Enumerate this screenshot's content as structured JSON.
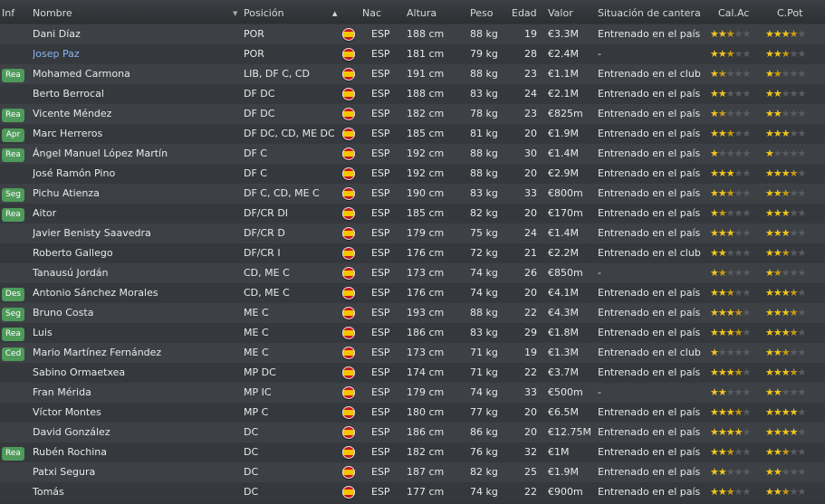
{
  "headers": {
    "inf": "Inf",
    "name": "Nombre",
    "pos": "Posición",
    "nat": "Nac",
    "height": "Altura",
    "weight": "Peso",
    "age": "Edad",
    "value": "Valor",
    "status": "Situación de cantera",
    "ca": "Cal.Ac",
    "pa": "C.Pot",
    "sort_arrow_name": "▼",
    "sort_arrow_pos": "▲"
  },
  "players": [
    {
      "inf": "",
      "name": "Dani Díaz",
      "pos": "POR",
      "nat": "ESP",
      "height": "188 cm",
      "weight": "88 kg",
      "age": "19",
      "value": "€3.3M",
      "status": "Entrenado en el país",
      "ca": 2.5,
      "pa": 3.5
    },
    {
      "inf": "",
      "name": "Josep Paz",
      "pos": "POR",
      "nat": "ESP",
      "height": "181 cm",
      "weight": "79 kg",
      "age": "28",
      "value": "€2.4M",
      "status": "-",
      "ca": 2.5,
      "pa": 2.5,
      "link": true
    },
    {
      "inf": "Rea",
      "name": "Mohamed Carmona",
      "pos": "LIB, DF C, CD",
      "nat": "ESP",
      "height": "191 cm",
      "weight": "88 kg",
      "age": "23",
      "value": "€1.1M",
      "status": "Entrenado en el club",
      "ca": 1.5,
      "pa": 1.5
    },
    {
      "inf": "",
      "name": "Berto Berrocal",
      "pos": "DF DC",
      "nat": "ESP",
      "height": "188 cm",
      "weight": "83 kg",
      "age": "24",
      "value": "€2.1M",
      "status": "Entrenado en el país",
      "ca": 2,
      "pa": 2
    },
    {
      "inf": "Rea",
      "name": "Vicente Méndez",
      "pos": "DF DC",
      "nat": "ESP",
      "height": "182 cm",
      "weight": "78 kg",
      "age": "23",
      "value": "€825m",
      "status": "Entrenado en el país",
      "ca": 1.5,
      "pa": 2
    },
    {
      "inf": "Apr",
      "name": "Marc Herreros",
      "pos": "DF DC, CD, ME DC",
      "nat": "ESP",
      "height": "185 cm",
      "weight": "81 kg",
      "age": "20",
      "value": "€1.9M",
      "status": "Entrenado en el país",
      "ca": 2.5,
      "pa": 3
    },
    {
      "inf": "Rea",
      "name": "Ángel Manuel López Martín",
      "pos": "DF C",
      "nat": "ESP",
      "height": "192 cm",
      "weight": "88 kg",
      "age": "30",
      "value": "€1.4M",
      "status": "Entrenado en el país",
      "ca": 1,
      "pa": 1
    },
    {
      "inf": "",
      "name": "José Ramón Pino",
      "pos": "DF C",
      "nat": "ESP",
      "height": "192 cm",
      "weight": "88 kg",
      "age": "20",
      "value": "€2.9M",
      "status": "Entrenado en el país",
      "ca": 3,
      "pa": 3.5
    },
    {
      "inf": "Seg",
      "name": "Pichu Atienza",
      "pos": "DF C, CD, ME C",
      "nat": "ESP",
      "height": "190 cm",
      "weight": "83 kg",
      "age": "33",
      "value": "€800m",
      "status": "Entrenado en el país",
      "ca": 2.5,
      "pa": 2.5
    },
    {
      "inf": "Rea",
      "name": "Aitor",
      "pos": "DF/CR DI",
      "nat": "ESP",
      "height": "185 cm",
      "weight": "82 kg",
      "age": "20",
      "value": "€170m",
      "status": "Entrenado en el país",
      "ca": 1.5,
      "pa": 3
    },
    {
      "inf": "",
      "name": "Javier Benisty Saavedra",
      "pos": "DF/CR D",
      "nat": "ESP",
      "height": "179 cm",
      "weight": "75 kg",
      "age": "24",
      "value": "€1.4M",
      "status": "Entrenado en el país",
      "ca": 3,
      "pa": 3
    },
    {
      "inf": "",
      "name": "Roberto Gallego",
      "pos": "DF/CR I",
      "nat": "ESP",
      "height": "176 cm",
      "weight": "72 kg",
      "age": "21",
      "value": "€2.2M",
      "status": "Entrenado en el club",
      "ca": 2,
      "pa": 2.5
    },
    {
      "inf": "",
      "name": "Tanausú Jordán",
      "pos": "CD, ME C",
      "nat": "ESP",
      "height": "173 cm",
      "weight": "74 kg",
      "age": "26",
      "value": "€850m",
      "status": "-",
      "ca": 1.5,
      "pa": 1.5
    },
    {
      "inf": "Des",
      "name": "Antonio Sánchez Morales",
      "pos": "CD, ME C",
      "nat": "ESP",
      "height": "176 cm",
      "weight": "74 kg",
      "age": "20",
      "value": "€4.1M",
      "status": "Entrenado en el país",
      "ca": 2.5,
      "pa": 3.5
    },
    {
      "inf": "Seg",
      "name": "Bruno Costa",
      "pos": "ME C",
      "nat": "ESP",
      "height": "193 cm",
      "weight": "88 kg",
      "age": "22",
      "value": "€4.3M",
      "status": "Entrenado en el país",
      "ca": 3.5,
      "pa": 3.5
    },
    {
      "inf": "Rea",
      "name": "Luis",
      "pos": "ME C",
      "nat": "ESP",
      "height": "186 cm",
      "weight": "83 kg",
      "age": "29",
      "value": "€1.8M",
      "status": "Entrenado en el país",
      "ca": 3.5,
      "pa": 3.5
    },
    {
      "inf": "Ced",
      "name": "Mario Martínez Fernández",
      "pos": "ME C",
      "nat": "ESP",
      "height": "173 cm",
      "weight": "71 kg",
      "age": "19",
      "value": "€1.3M",
      "status": "Entrenado en el club",
      "ca": 1,
      "pa": 2.5
    },
    {
      "inf": "",
      "name": "Sabino Ormaetxea",
      "pos": "MP DC",
      "nat": "ESP",
      "height": "174 cm",
      "weight": "71 kg",
      "age": "22",
      "value": "€3.7M",
      "status": "Entrenado en el país",
      "ca": 3.5,
      "pa": 3.5
    },
    {
      "inf": "",
      "name": "Fran Mérida",
      "pos": "MP IC",
      "nat": "ESP",
      "height": "179 cm",
      "weight": "74 kg",
      "age": "33",
      "value": "€500m",
      "status": "-",
      "ca": 2,
      "pa": 2
    },
    {
      "inf": "",
      "name": "Víctor Montes",
      "pos": "MP C",
      "nat": "ESP",
      "height": "180 cm",
      "weight": "77 kg",
      "age": "20",
      "value": "€6.5M",
      "status": "Entrenado en el país",
      "ca": 3.5,
      "pa": 4
    },
    {
      "inf": "",
      "name": "David González",
      "pos": "DC",
      "nat": "ESP",
      "height": "186 cm",
      "weight": "86 kg",
      "age": "20",
      "value": "€12.75M",
      "status": "Entrenado en el país",
      "ca": 4,
      "pa": 4
    },
    {
      "inf": "Rea",
      "name": "Rubén Rochina",
      "pos": "DC",
      "nat": "ESP",
      "height": "182 cm",
      "weight": "76 kg",
      "age": "32",
      "value": "€1M",
      "status": "Entrenado en el país",
      "ca": 2.5,
      "pa": 2.5
    },
    {
      "inf": "",
      "name": "Patxi Segura",
      "pos": "DC",
      "nat": "ESP",
      "height": "187 cm",
      "weight": "82 kg",
      "age": "25",
      "value": "€1.9M",
      "status": "Entrenado en el país",
      "ca": 2,
      "pa": 2
    },
    {
      "inf": "",
      "name": "Tomás",
      "pos": "DC",
      "nat": "ESP",
      "height": "177 cm",
      "weight": "74 kg",
      "age": "22",
      "value": "€900m",
      "status": "Entrenado en el país",
      "ca": 2.5,
      "pa": 2.5
    }
  ],
  "colors": {
    "badge": "#4e9a5a",
    "star": "#f2c51c",
    "link": "#8ab4f0"
  }
}
